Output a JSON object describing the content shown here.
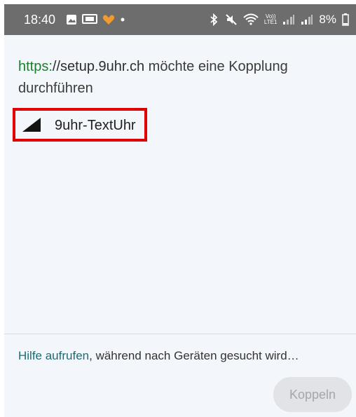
{
  "status_bar": {
    "time": "18:40",
    "battery": "8%",
    "left_icons": [
      "gallery-icon",
      "cast-icon",
      "heart-app-icon",
      "notification-dot-icon"
    ],
    "right_icons": [
      "bluetooth-icon",
      "mute-icon",
      "wifi-icon",
      "volte-icon",
      "signal-icon",
      "signal-icon-2",
      "battery-icon"
    ],
    "net_label_top": "Vo))",
    "net_label_bottom": "LTE1"
  },
  "dialog": {
    "url_scheme": "https:",
    "url_host": "//setup.9uhr.ch",
    "request_text": " möchte eine Kopplung durchführen",
    "device": {
      "name": "9uhr-TextUhr",
      "icon": "signal-strength-icon"
    },
    "help_link": "Hilfe aufrufen",
    "help_rest": ", während nach Geräten gesucht wird…",
    "connect_label": "Koppeln"
  },
  "colors": {
    "status_bar": "#6d6d6d",
    "background": "#f3f6fb",
    "url_scheme": "#1a7f2a",
    "help_link": "#1e6b73",
    "highlight_box": "#e00000",
    "button_bg": "#e1e3e6",
    "button_text": "#a4a6a9"
  }
}
